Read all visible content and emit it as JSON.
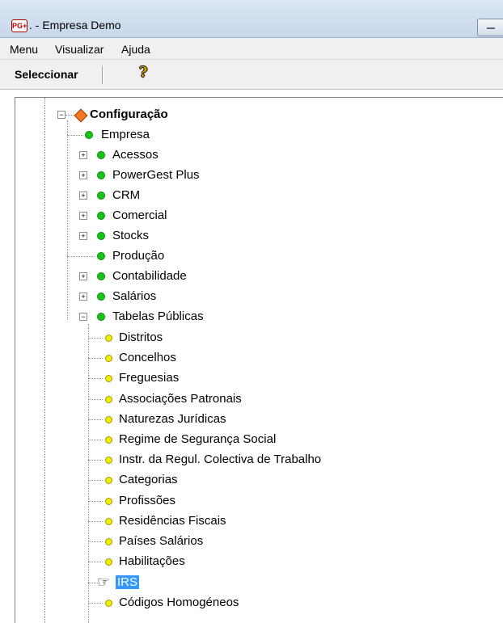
{
  "window": {
    "title": ". - Empresa Demo",
    "logo_text": "PG+"
  },
  "menubar": {
    "items": [
      {
        "label": "Menu",
        "icon": ""
      },
      {
        "label": "Visualizar",
        "icon": ""
      },
      {
        "label": "Ajuda",
        "icon": ""
      }
    ]
  },
  "toolbar": {
    "select_label": "Seleccionar",
    "help_icon": "?"
  },
  "tree": {
    "root": {
      "label": "Configuração",
      "icon": "orange-diamond-icon",
      "expanded": true
    },
    "items": [
      {
        "label": "Empresa",
        "expander": "",
        "bullet": "green"
      },
      {
        "label": "Acessos",
        "expander": "+",
        "bullet": "green"
      },
      {
        "label": "PowerGest Plus",
        "expander": "+",
        "bullet": "green"
      },
      {
        "label": "CRM",
        "expander": "+",
        "bullet": "green"
      },
      {
        "label": "Comercial",
        "expander": "+",
        "bullet": "green"
      },
      {
        "label": "Stocks",
        "expander": "+",
        "bullet": "green"
      },
      {
        "label": "Produção",
        "expander": "",
        "bullet": "green"
      },
      {
        "label": "Contabilidade",
        "expander": "+",
        "bullet": "green"
      },
      {
        "label": "Salários",
        "expander": "+",
        "bullet": "green"
      },
      {
        "label": "Tabelas Públicas",
        "expander": "−",
        "bullet": "green"
      }
    ],
    "children": [
      {
        "label": "Distritos",
        "bullet": "yellow"
      },
      {
        "label": "Concelhos",
        "bullet": "yellow"
      },
      {
        "label": "Freguesias",
        "bullet": "yellow"
      },
      {
        "label": "Associações Patronais",
        "bullet": "yellow"
      },
      {
        "label": "Naturezas Jurídicas",
        "bullet": "yellow"
      },
      {
        "label": "Regime de Segurança Social",
        "bullet": "yellow"
      },
      {
        "label": "Instr. da Regul. Colectiva de Trabalho",
        "bullet": "yellow"
      },
      {
        "label": "Categorias",
        "bullet": "yellow"
      },
      {
        "label": "Profissões",
        "bullet": "yellow"
      },
      {
        "label": "Residências Fiscais",
        "bullet": "yellow"
      },
      {
        "label": "Países Salários",
        "bullet": "yellow"
      },
      {
        "label": "Habilitações",
        "bullet": "yellow"
      },
      {
        "label": "IRS",
        "bullet": "hand",
        "selected": true
      },
      {
        "label": "Códigos Homogéneos",
        "bullet": "yellow"
      }
    ]
  }
}
